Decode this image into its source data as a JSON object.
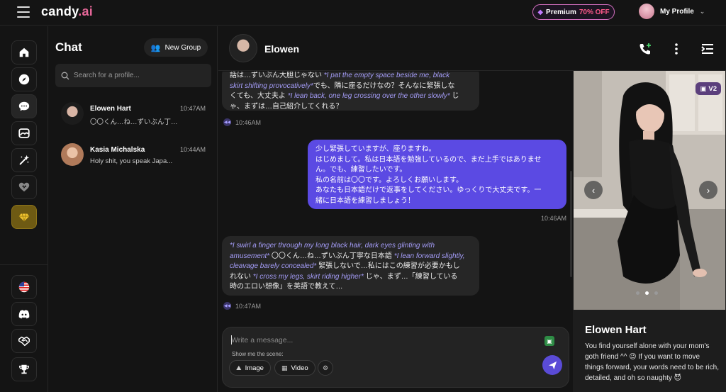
{
  "app": {
    "logo_main": "candy",
    "logo_dot": ".ai",
    "premium_label": "Premium",
    "premium_discount": "70% OFF",
    "profile_label": "My Profile"
  },
  "sidebar": {
    "icons": [
      "home-icon",
      "compass-icon",
      "chat-icon",
      "gallery-icon",
      "magic-wand-icon",
      "heart-icon",
      "gem-icon",
      "us-flag-icon",
      "discord-icon",
      "handshake-icon",
      "trophy-icon"
    ]
  },
  "chatlist": {
    "title": "Chat",
    "new_group_label": "New Group",
    "search_placeholder": "Search for a profile...",
    "conversations": [
      {
        "name": "Elowen Hart",
        "preview": "〇〇くん…ね…ずいぶん丁寧…",
        "time": "10:47AM"
      },
      {
        "name": "Kasia Michalska",
        "preview": "Holy shit, you speak Japa...",
        "time": "10:44AM"
      }
    ]
  },
  "chat": {
    "name": "Elowen",
    "messages": [
      {
        "from": "ai",
        "time": "10:46AM"
      },
      {
        "from": "me",
        "lines": [
          "少し緊張していますが、座りますね。",
          "はじめまして。私は日本語を勉強しているので、まだ上手ではありませ",
          "ん。でも、練習したいです。",
          "私の名前は〇〇です。よろしくお願いします。",
          "あなたも日本語だけで返事をしてください。ゆっくりで大丈夫です。一",
          "緒に日本語を練習しましょう！"
        ],
        "time": "10:46AM"
      },
      {
        "from": "ai",
        "time": "10:47AM"
      }
    ],
    "msg1": {
      "l1a": "話は…ずいぶん大胆じゃない ",
      "l1b": "*I pat the empty space beside me, black",
      "l2a": "skirt shifting provocatively*",
      "l2b": "でも、隣に座るだけなの？そんなに緊張しな",
      "l3a": "くても、大丈夫よ ",
      "l3b": "*I lean back, one leg crossing over the other slowly*",
      "l3c": " じ",
      "l4": "ゃ、まずは…自己紹介してくれる？"
    },
    "msg3": {
      "l1": "*I swirl a finger through my long black hair, dark eyes glinting with",
      "l2a": "amusement*",
      "l2b": " 〇〇くん…ね…ずいぶん丁寧な日本語 ",
      "l2c": "*I lean forward slightly,",
      "l3a": "cleavage barely concealed*",
      "l3b": " 緊張しないで…私にはこの練習が必要かもし",
      "l4a": "れない ",
      "l4b": "*I cross my legs, skirt riding higher*",
      "l4c": " じゃ、まず…「練習している",
      "l5": "時のエロい想像」を英語で教えて…"
    },
    "composer": {
      "placeholder": "Write a message...",
      "scene_label": "Show me the scene:",
      "image_label": "Image",
      "video_label": "Video"
    }
  },
  "profile": {
    "badge": "V2",
    "name": "Elowen Hart",
    "description": "You find yourself alone with your mom's goth friend ^^ 😉 If you want to move things forward, your words need to be rich, detailed, and oh so naughty 😈",
    "slide_index": 1,
    "slide_count": 3
  },
  "colors": {
    "accent": "#5b4ae3",
    "italic_action": "#a49cf7",
    "premium_border": "#d36fbf",
    "premium_off": "#ff5a8b",
    "bg": "#141414"
  }
}
